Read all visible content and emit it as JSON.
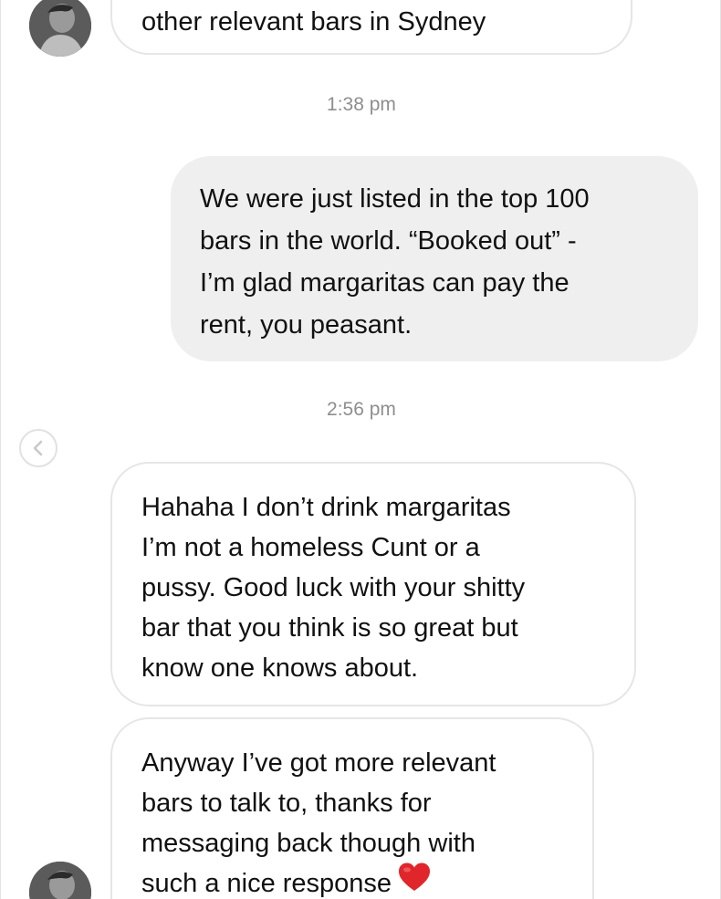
{
  "thread": {
    "message_top": {
      "lines": [
        "other relevant bars in Sydney"
      ]
    },
    "time_1": "1:38 pm",
    "message_sent": {
      "lines": [
        "We were just listed in the top 100",
        "bars in the world. “Booked out” -",
        "I’m glad margaritas can pay the",
        "rent, you peasant."
      ]
    },
    "time_2": "2:56 pm",
    "message_reply_1": {
      "lines": [
        "Hahaha I don’t drink margaritas",
        "I’m not a homeless Cunt or a",
        "pussy. Good luck with your shitty",
        "bar that you think is so great but",
        "know one knows about."
      ]
    },
    "message_reply_2": {
      "lines": [
        "Anyway I’ve got more relevant",
        "bars to talk to, thanks for",
        "messaging back though with",
        "such a nice response"
      ],
      "emoji": "heart-emoji"
    }
  },
  "colors": {
    "incoming_border": "#e6e6e6",
    "outgoing_fill": "#efefef",
    "timestamp": "#8e8e8e",
    "heart": "#e0262b"
  },
  "icons": [
    "avatar",
    "back-chevron-icon",
    "heart-emoji"
  ]
}
